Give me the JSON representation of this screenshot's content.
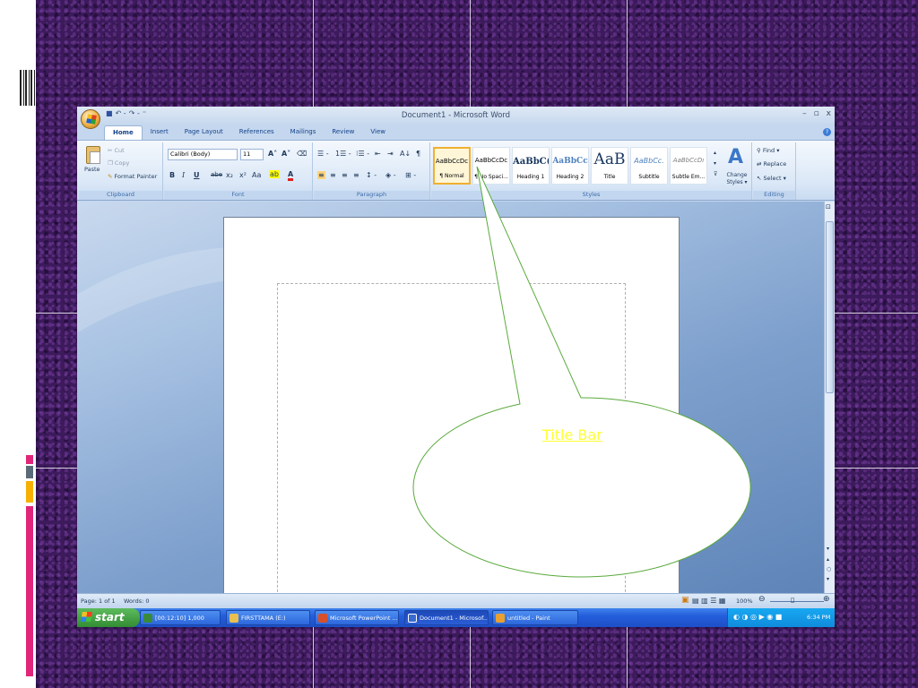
{
  "window": {
    "title": "Document1 - Microsoft Word",
    "minimize": "–",
    "maximize": "▫",
    "close": "x"
  },
  "qat": {
    "save": "■",
    "undo": "↶ -",
    "redo": "↷ -",
    "customize": "⁼"
  },
  "tabs": [
    "Home",
    "Insert",
    "Page Layout",
    "References",
    "Mailings",
    "Review",
    "View"
  ],
  "clipboard": {
    "paste": "Paste",
    "cut": "Cut",
    "copy": "Copy",
    "format_painter": "Format Painter",
    "label": "Clipboard"
  },
  "font": {
    "name": "Calibri (Body)",
    "size": "11",
    "grow": "A˄",
    "shrink": "A˅",
    "clear": "⌫",
    "bold": "B",
    "italic": "I",
    "underline": "U",
    "strike": "abe",
    "sub": "x₂",
    "sup": "x²",
    "case": "Aa",
    "highlight": "ab",
    "color": "A",
    "label": "Font"
  },
  "paragraph": {
    "bullets": "☰ -",
    "numbering": "1☰ -",
    "multilevel": "⁝☰ -",
    "decrease": "⇤",
    "increase": "⇥",
    "sort": "A↓",
    "show": "¶",
    "align_left": "≡",
    "center": "≡",
    "align_right": "≡",
    "justify": "≡",
    "spacing": "↕ -",
    "shading": "◈ -",
    "borders": "⊞ -",
    "label": "Paragraph"
  },
  "styles": {
    "tiles": [
      {
        "sample": "AaBbCcDc",
        "name": "¶ Normal"
      },
      {
        "sample": "AaBbCcDc",
        "name": "¶ No Spaci..."
      },
      {
        "sample": "AaBbC(",
        "name": "Heading 1"
      },
      {
        "sample": "AaBbCc",
        "name": "Heading 2"
      },
      {
        "sample": "AaB",
        "name": "Title"
      },
      {
        "sample": "AaBbCc.",
        "name": "Subtitle"
      },
      {
        "sample": "AaBbCcDı",
        "name": "Subtle Em..."
      }
    ],
    "change_styles": "Change Styles ▾",
    "label": "Styles"
  },
  "editing": {
    "find": "Find ▾",
    "replace": "Replace",
    "select": "Select ▾",
    "label": "Editing"
  },
  "status": {
    "page": "Page: 1 of 1",
    "words": "Words: 0",
    "zoom": "100%"
  },
  "taskbar": {
    "start": "start",
    "buttons": [
      "[00:12:10] 1,000",
      "FIRSTTAMA (E:)",
      "Microsoft PowerPoint ...",
      "Document1 - Microsof...",
      "untitled - Paint"
    ],
    "clock": "6:34 PM"
  },
  "callout": {
    "text": "Title Bar"
  },
  "colors": {
    "accent": "#ffff33",
    "callout_stroke": "#5aaa3c",
    "ribbon": "#dbe8f7",
    "background": "#3c1a5c"
  }
}
